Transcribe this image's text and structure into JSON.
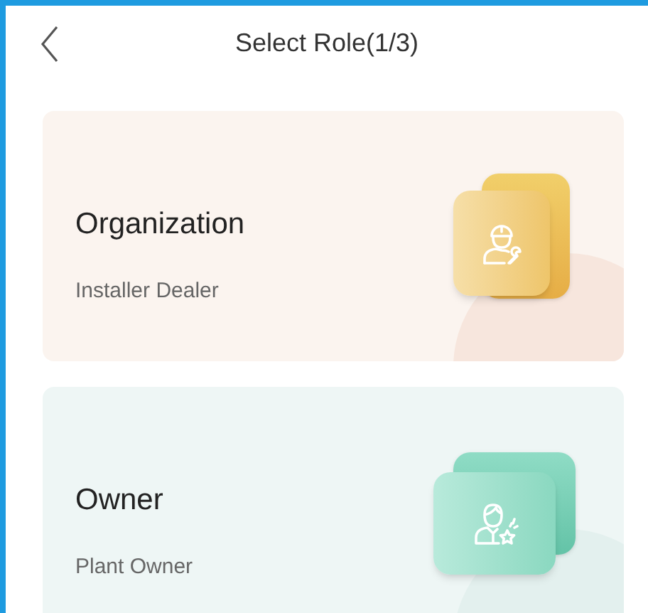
{
  "header": {
    "title": "Select Role(1/3)"
  },
  "roles": [
    {
      "kind": "organization",
      "title": "Organization",
      "subtitle": "Installer Dealer"
    },
    {
      "kind": "owner",
      "title": "Owner",
      "subtitle": "Plant Owner"
    }
  ]
}
